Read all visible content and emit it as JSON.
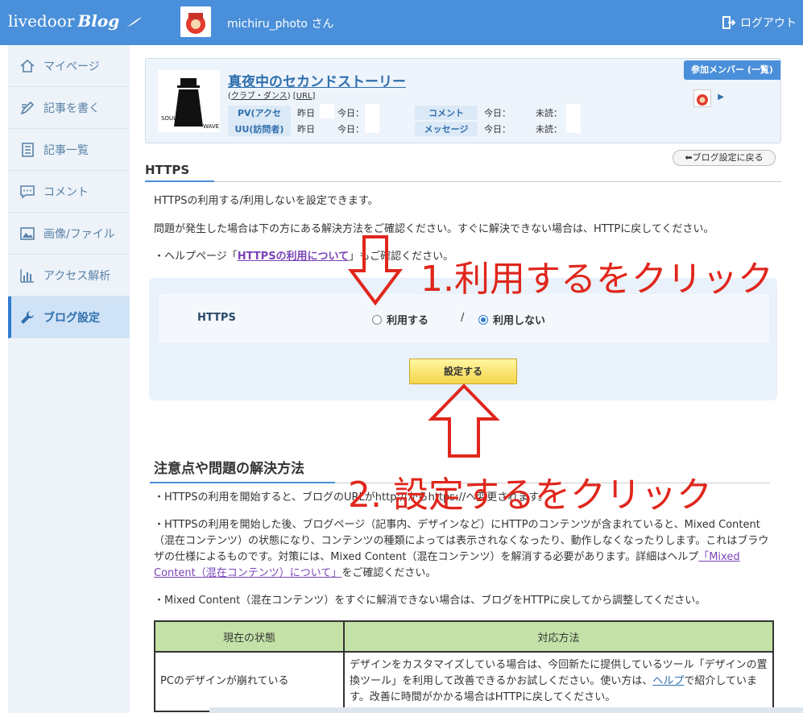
{
  "header": {
    "logo_text": "livedoor",
    "logo_blog": "Blog",
    "username": "michiru_photo さん",
    "logout_label": "ログアウト"
  },
  "sidebar": {
    "items": [
      {
        "label": "マイページ",
        "icon": "home-icon"
      },
      {
        "label": "記事を書く",
        "icon": "pen-icon"
      },
      {
        "label": "記事一覧",
        "icon": "list-icon"
      },
      {
        "label": "コメント",
        "icon": "comment-icon"
      },
      {
        "label": "画像/ファイル",
        "icon": "image-icon"
      },
      {
        "label": "アクセス解析",
        "icon": "chart-icon"
      },
      {
        "label": "ブログ設定",
        "icon": "wrench-icon",
        "active": true
      }
    ]
  },
  "profile": {
    "blog_title": "真夜中のセカンドストーリー",
    "category": "クラブ・ダンス",
    "url_label": "URL",
    "pv_label": "PV(アクセス)",
    "uu_label": "UU(訪問者)",
    "yesterday": "昨日",
    "today": "今日：",
    "comment_label": "コメント",
    "message_label": "メッセージ",
    "unread": "未読：",
    "members_button": "参加メンバー (一覧)",
    "thumb_text_left": "SOUL",
    "thumb_text_right": "WAVE"
  },
  "settings": {
    "back_button": "ブログ設定に戻る",
    "heading": "HTTPS",
    "desc1": "HTTPSの利用する/利用しないを設定できます。",
    "desc2": "問題が発生した場合は下の方にある解決方法をご確認ください。すぐに解決できない場合は、HTTPに戻してください。",
    "help_prefix": "・ヘルプページ「",
    "help_link": "HTTPSの利用について",
    "help_suffix": "」もご確認ください。",
    "https_label": "HTTPS",
    "option_use": "利用する",
    "option_separator": "/",
    "option_not_use": "利用しない",
    "selected": "利用しない",
    "submit_label": "設定する"
  },
  "annotations": {
    "step1": "1.利用するをクリック",
    "step2": "2. 設定するをクリック"
  },
  "notes": {
    "heading": "注意点や問題の解決方法",
    "note1": "・HTTPSの利用を開始すると、ブログのURLがhttp://からhttps://へ変更されます。",
    "note2": "・HTTPSの利用を開始した後、ブログページ（記事内、デザインなど）にHTTPのコンテンツが含まれていると、Mixed Content（混在コンテンツ）の状態になり、コンテンツの種類によっては表示されなくなったり、動作しなくなったりします。これはブラウザの仕様によるものです。対策には、Mixed Content（混在コンテンツ）を解消する必要があります。詳細はヘルプ",
    "note2_link": "「Mixed Content（混在コンテンツ）について」",
    "note2_suffix": "をご確認ください。",
    "note3": "・Mixed Content（混在コンテンツ）をすぐに解消できない場合は、ブログをHTTPに戻してから調整してください。"
  },
  "table": {
    "col1": "現在の状態",
    "col2": "対応方法",
    "row1_state": "PCのデザインが崩れている",
    "row1_fix_prefix": "デザインをカスタマイズしている場合は、今回新たに提供しているツール「デザインの置換ツール」を利用して改善できるかお試しください。使い方は、",
    "row1_fix_link": "ヘルプ",
    "row1_fix_suffix": "で紹介しています。改善に時間がかかる場合はHTTPに戻してください。"
  }
}
